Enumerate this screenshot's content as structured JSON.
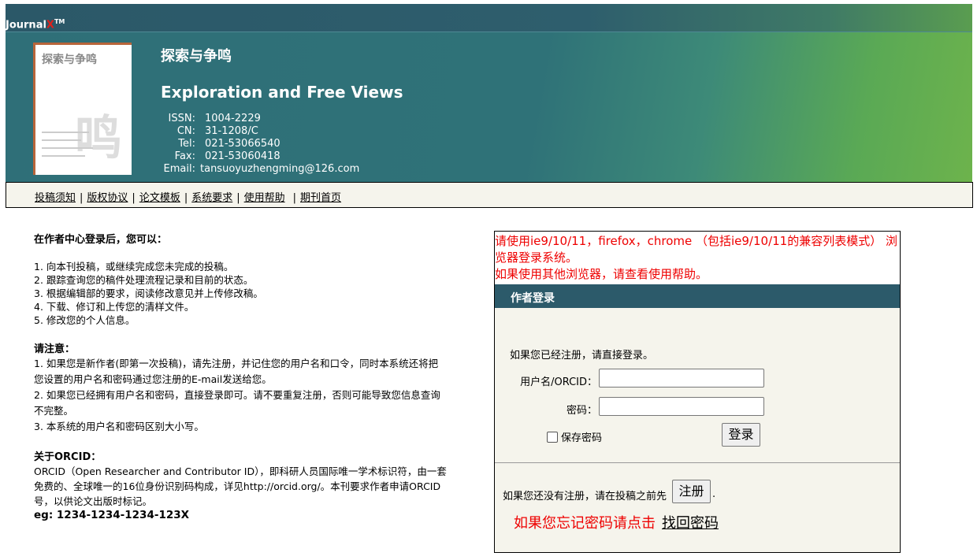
{
  "header": {
    "logo_text": "Journal",
    "logo_x": "X",
    "logo_tm": "TM",
    "cover_title": "探索与争鸣",
    "cn_title": "探索与争鸣",
    "en_title": "Exploration and Free Views",
    "info": [
      {
        "k": "ISSN:",
        "v": "1004-2229"
      },
      {
        "k": "CN:",
        "v": "31-1208/C"
      },
      {
        "k": "Tel:",
        "v": "021-53066540"
      },
      {
        "k": "Fax:",
        "v": "021-53060418"
      },
      {
        "k": "Email:",
        "v": "tansuoyuzhengming@126.com"
      }
    ]
  },
  "nav": [
    "投稿须知",
    "版权协议",
    "论文模板",
    "系统要求",
    "使用帮助",
    "期刊首页"
  ],
  "left": {
    "heading1": "在作者中心登录后，您可以：",
    "items": [
      "1. 向本刊投稿，或继续完成您未完成的投稿。",
      "2. 跟踪查询您的稿件处理流程记录和目前的状态。",
      "3. 根据编辑部的要求，阅读修改意见并上传修改稿。",
      "4. 下载、修订和上传您的清样文件。",
      "5. 修改您的个人信息。"
    ],
    "heading2": "请注意：",
    "notes": [
      "1. 如果您是新作者(即第一次投稿)，请先注册，并记住您的用户名和口令，同时本系统还将把您设置的用户名和密码通过您注册的E-mail发送给您。",
      "2. 如果您已经拥有用户名和密码，直接登录即可。请不要重复注册，否则可能导致您信息查询不完整。",
      "3. 本系统的用户名和密码区别大小写。"
    ],
    "heading3": "关于ORCID：",
    "orcid_text": "ORCID（Open Researcher and Contributor ID），即科研人员国际唯一学术标识符，由一套免费的、全球唯一的16位身份识别码构成，详见http://orcid.org/。本刊要求作者申请ORCID号，以供论文出版时标记。",
    "example": "eg: 1234-1234-1234-123X"
  },
  "login": {
    "warning1": "请使用ie9/10/11，firefox，chrome （包括ie9/10/11的兼容列表模式） 浏览器登录系统。",
    "warning2": "如果使用其他浏览器，请查看使用帮助。",
    "title": "作者登录",
    "registered_text": "如果您已经注册，请直接登录。",
    "username_label": "用户名/ORCID：",
    "username_value": "",
    "password_label": "密码：",
    "password_value": "",
    "remember_label": "保存密码",
    "login_button": "登录",
    "not_registered_text": "如果您还没有注册，请在投稿之前先",
    "register_button": "注册",
    "period": ".",
    "forgot_text": "如果您忘记密码请点击",
    "forgot_link": "找回密码"
  }
}
